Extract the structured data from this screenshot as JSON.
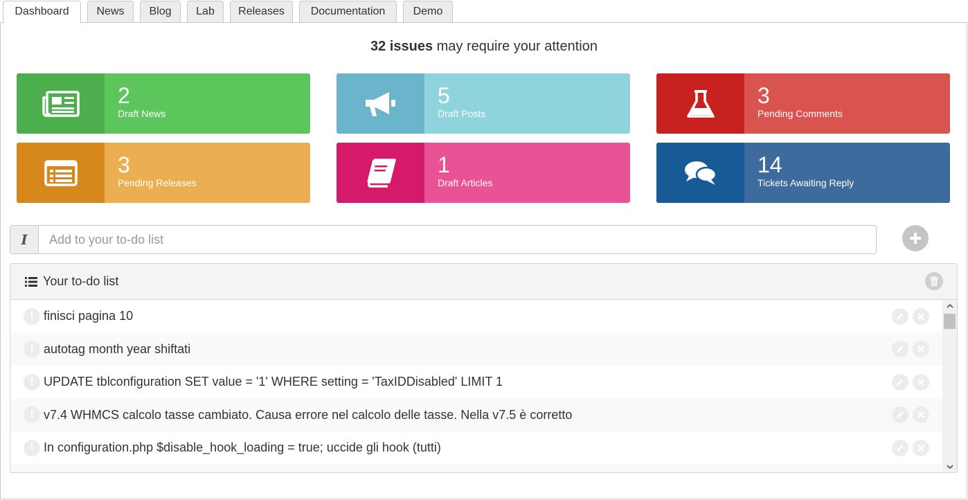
{
  "tabs": [
    {
      "label": "Dashboard",
      "active": true
    },
    {
      "label": "News"
    },
    {
      "label": "Blog"
    },
    {
      "label": "Lab"
    },
    {
      "label": "Releases"
    },
    {
      "label": "Documentation"
    },
    {
      "label": "Demo"
    }
  ],
  "headline": {
    "count": "32 issues",
    "suffix": " may require your attention"
  },
  "tiles": [
    {
      "value": "2",
      "label": "Draft News",
      "icon": "newspaper-icon",
      "icon_bg": "#4cae4c",
      "bg": "#5cc65c"
    },
    {
      "value": "5",
      "label": "Draft Posts",
      "icon": "megaphone-icon",
      "icon_bg": "#6ab4cc",
      "bg": "#8fd4dc"
    },
    {
      "value": "3",
      "label": "Pending Comments",
      "icon": "flask-icon",
      "icon_bg": "#c92020",
      "bg": "#d9534f"
    },
    {
      "value": "3",
      "label": "Pending Releases",
      "icon": "list-card-icon",
      "icon_bg": "#d6881c",
      "bg": "#ebaf52"
    },
    {
      "value": "1",
      "label": "Draft Articles",
      "icon": "book-icon",
      "icon_bg": "#d51a6a",
      "bg": "#e95395"
    },
    {
      "value": "14",
      "label": "Tickets Awaiting Reply",
      "icon": "comments-icon",
      "icon_bg": "#165a96",
      "bg": "#3d6b9d"
    }
  ],
  "todo": {
    "input_addon": "I",
    "input_placeholder": "Add to your to-do list",
    "list_title": "Your to-do list",
    "items": [
      "finisci pagina 10",
      "autotag month year shiftati",
      "UPDATE tblconfiguration SET value = '1' WHERE setting = 'TaxIDDisabled' LIMIT 1",
      "v7.4 WHMCS calcolo tasse cambiato. Causa errore nel calcolo delle tasse. Nella v7.5 è corretto",
      "In configuration.php $disable_hook_loading = true; uccide gli hook (tutti)"
    ]
  }
}
